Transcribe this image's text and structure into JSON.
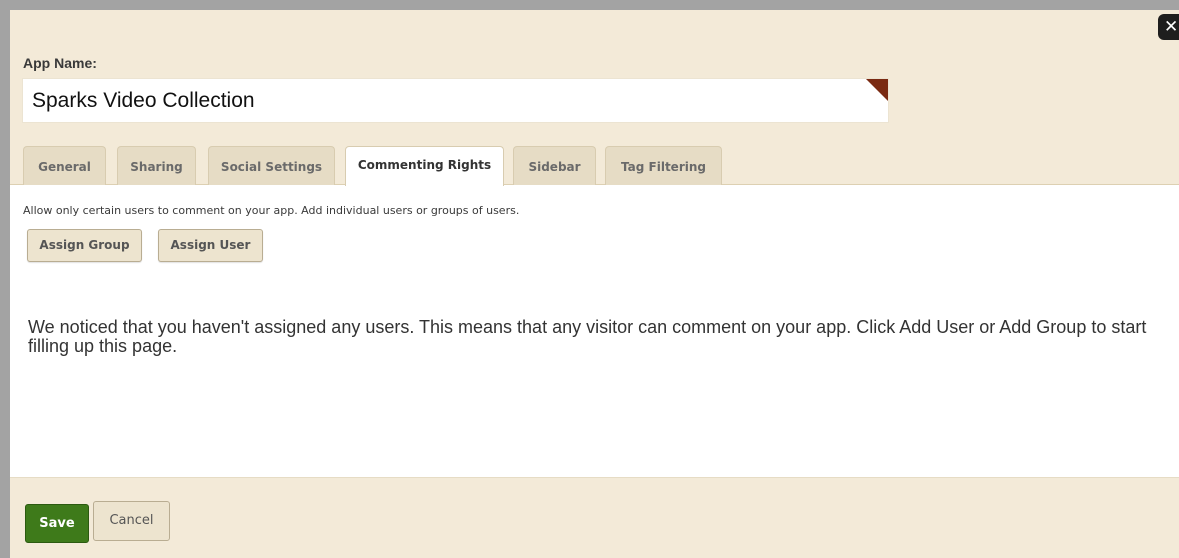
{
  "dialog": {
    "close_glyph": "✕"
  },
  "app_name": {
    "label": "App Name:",
    "value": "Sparks Video Collection"
  },
  "tabs": [
    {
      "label": "General",
      "active": false
    },
    {
      "label": "Sharing",
      "active": false
    },
    {
      "label": "Social Settings",
      "active": false
    },
    {
      "label": "Commenting Rights",
      "active": true
    },
    {
      "label": "Sidebar",
      "active": false
    },
    {
      "label": "Tag Filtering",
      "active": false
    }
  ],
  "commenting_rights": {
    "description": "Allow only certain users to comment on your app. Add individual users or groups of users.",
    "assign_group_label": "Assign Group",
    "assign_user_label": "Assign User",
    "notice": "We noticed that you haven't assigned any users. This means that any visitor can comment on your app. Click Add User or Add Group to start filling up this page."
  },
  "footer": {
    "save_label": "Save",
    "cancel_label": "Cancel"
  },
  "colors": {
    "panel_bg": "#f3ead8",
    "save_green": "#3e7a1a",
    "field_corner": "#7a2a12"
  }
}
